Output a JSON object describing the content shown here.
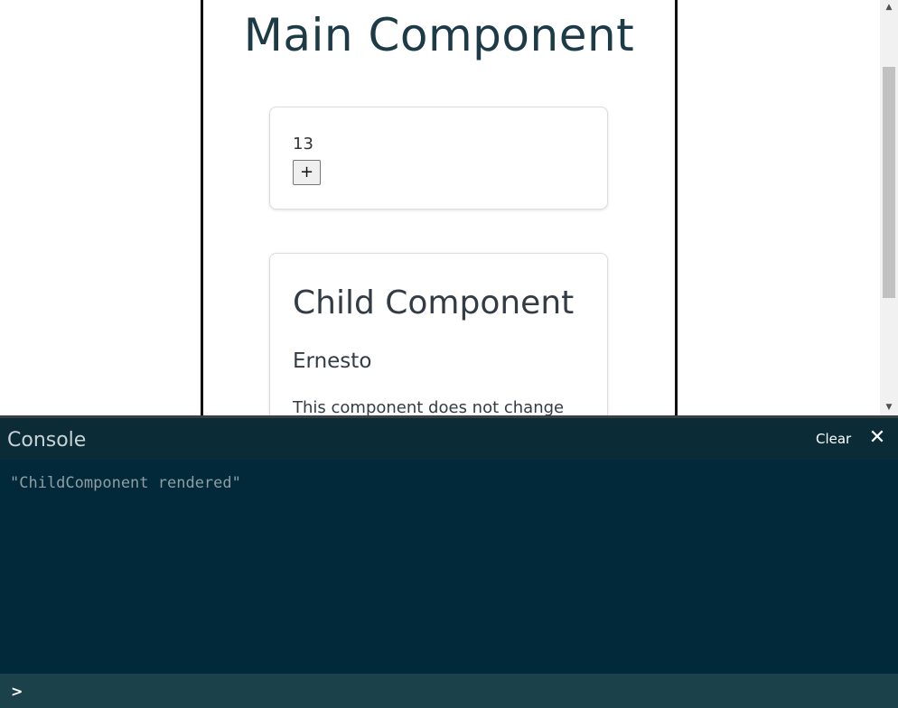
{
  "preview": {
    "main_title": "Main Component",
    "counter": {
      "value": "13",
      "increment_label": "+"
    },
    "child": {
      "title": "Child Component",
      "name": "Ernesto",
      "note": "This component does not change"
    }
  },
  "console": {
    "title": "Console",
    "clear_label": "Clear",
    "close_label": "✕",
    "logs": [
      "\"ChildComponent rendered\""
    ],
    "prompt": ">",
    "input_value": ""
  },
  "scrollbar": {
    "up_arrow": "▲",
    "down_arrow": "▼"
  },
  "colors": {
    "console_bg": "#012939",
    "console_header_bg": "#0b2c37",
    "console_input_bg": "#1b414b",
    "main_title": "#1c3b47"
  }
}
